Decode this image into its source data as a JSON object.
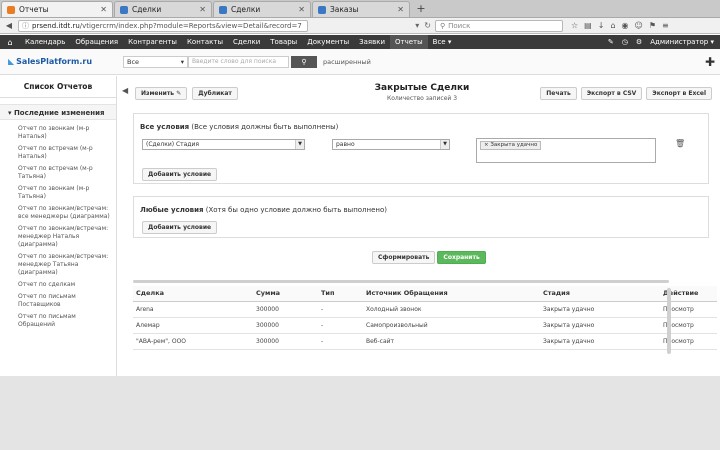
{
  "browser": {
    "tabs": [
      {
        "label": "Отчеты",
        "active": true,
        "color": "orange"
      },
      {
        "label": "Сделки",
        "active": false,
        "color": "blue"
      },
      {
        "label": "Сделки",
        "active": false,
        "color": "blue"
      },
      {
        "label": "Заказы",
        "active": false,
        "color": "blue"
      }
    ],
    "url_domain": "prsend.itdt.ru",
    "url_path": "/vtigercrm/index.php?module=Reports&view=Detail&record=7",
    "search_placeholder": "Поиск"
  },
  "appnav": {
    "items": [
      "Календарь",
      "Обращения",
      "Контрагенты",
      "Контакты",
      "Сделки",
      "Товары",
      "Документы",
      "Заявки",
      "Отчеты",
      "Все"
    ],
    "active": "Отчеты",
    "user": "Администратор"
  },
  "secbar": {
    "logo": "SalesPlatform.ru",
    "select_value": "Все",
    "search_placeholder": "Введите слово для поиска",
    "advanced": "расширенный"
  },
  "sidebar": {
    "title": "Список Отчетов",
    "section": "Последние изменения",
    "items": [
      "Отчет по звонкам (м-р Наталья)",
      "Отчет по встречам (м-р Наталья)",
      "Отчет по встречам (м-р Татьяна)",
      "Отчет по звонкам (м-р Татьяна)",
      "Отчет по звонкам/встречам: все менеджеры (диаграмма)",
      "Отчет по звонкам/встречам: менеджер Наталья (диаграмма)",
      "Отчет по звонкам/встречам: менеджер Татьяна (диаграмма)",
      "Отчет по сделкам",
      "Отчет по письмам Поставщиков",
      "Отчет по письмам Обращений"
    ]
  },
  "report": {
    "title": "Закрытые Сделки",
    "subtitle": "Количество записей 3",
    "edit_label": "Изменить",
    "duplicate_label": "Дубликат",
    "print_label": "Печать",
    "export_csv": "Экспорт в CSV",
    "export_excel": "Экспорт в Excel",
    "all_title_bold": "Все условия",
    "all_title_note": "(Все условия должны быть выполнены)",
    "field_value": "(Сделки) Стадия",
    "operator_value": "равно",
    "chip_value": "Закрыта удачно",
    "add_condition": "Добавить условие",
    "any_title_bold": "Любые условия",
    "any_title_note": "(Хотя бы одно условие должно быть выполнено)",
    "generate_label": "Сформировать",
    "save_label": "Сохранить"
  },
  "table": {
    "headers": [
      "Сделка",
      "Сумма",
      "Тип",
      "Источник Обращения",
      "Стадия",
      "Действие"
    ],
    "rows": [
      [
        "Arena",
        "300000",
        "-",
        "Холодный звонок",
        "Закрыта удачно",
        "Просмотр"
      ],
      [
        "Алемар",
        "300000",
        "-",
        "Самопроизвольный",
        "Закрыта удачно",
        "Просмотр"
      ],
      [
        "\"АВА-рем\", ООО",
        "300000",
        "-",
        "Веб-сайт",
        "Закрыта удачно",
        "Просмотр"
      ]
    ]
  }
}
